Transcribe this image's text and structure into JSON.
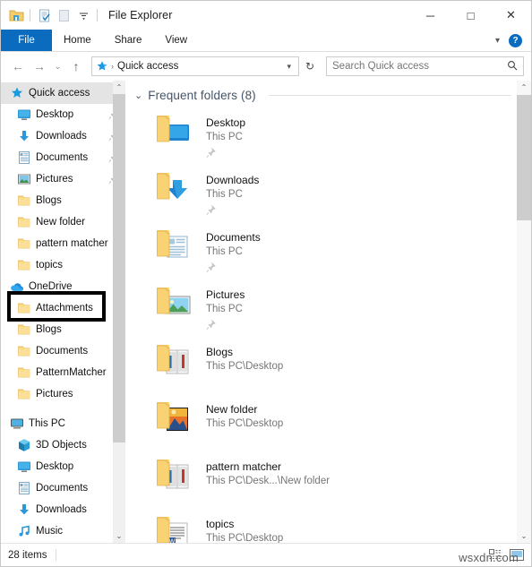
{
  "window": {
    "title": "File Explorer",
    "quick_access_toolbar": [
      {
        "icon": "folder-icon",
        "name": "explorer-icon"
      },
      {
        "icon": "properties-icon",
        "name": "properties-icon"
      },
      {
        "icon": "new-folder-icon",
        "name": "new-folder-icon"
      },
      {
        "icon": "chevron-down-icon",
        "name": "customize-qat-icon"
      }
    ],
    "controls": {
      "minimize": "─",
      "maximize": "□",
      "close": "✕"
    }
  },
  "ribbon": {
    "file_tab": "File",
    "tabs": [
      "Home",
      "Share",
      "View"
    ],
    "minimize_ribbon": "chevron-down-icon",
    "help": "?"
  },
  "addressbar": {
    "back": "←",
    "forward": "→",
    "recent": "⌄",
    "up": "↑",
    "crumb_icon": "quick-access-star-icon",
    "crumb_separator": "›",
    "crumb_label": "Quick access",
    "dropdown": "⌄",
    "refresh": "↻",
    "search_placeholder": "Search Quick access",
    "search_value": "",
    "search_icon": "search-icon"
  },
  "nav_pane": {
    "items": [
      {
        "label": "Quick access",
        "icon": "quick-access-star-icon",
        "level": 0,
        "selected": true,
        "pinned": false
      },
      {
        "label": "Desktop",
        "icon": "desktop-icon",
        "level": 1,
        "selected": false,
        "pinned": true
      },
      {
        "label": "Downloads",
        "icon": "downloads-icon",
        "level": 1,
        "selected": false,
        "pinned": true
      },
      {
        "label": "Documents",
        "icon": "documents-icon",
        "level": 1,
        "selected": false,
        "pinned": true
      },
      {
        "label": "Pictures",
        "icon": "pictures-icon",
        "level": 1,
        "selected": false,
        "pinned": true
      },
      {
        "label": "Blogs",
        "icon": "folder-icon",
        "level": 1,
        "selected": false,
        "pinned": false
      },
      {
        "label": "New folder",
        "icon": "folder-icon",
        "level": 1,
        "selected": false,
        "pinned": false
      },
      {
        "label": "pattern matcher",
        "icon": "folder-icon",
        "level": 1,
        "selected": false,
        "pinned": false
      },
      {
        "label": "topics",
        "icon": "folder-icon",
        "level": 1,
        "selected": false,
        "pinned": false
      },
      {
        "label": "OneDrive",
        "icon": "onedrive-cloud-icon",
        "level": 0,
        "selected": false,
        "pinned": false,
        "highlighted": true
      },
      {
        "label": "Attachments",
        "icon": "folder-icon",
        "level": 1,
        "selected": false,
        "pinned": false
      },
      {
        "label": "Blogs",
        "icon": "folder-icon",
        "level": 1,
        "selected": false,
        "pinned": false
      },
      {
        "label": "Documents",
        "icon": "folder-icon",
        "level": 1,
        "selected": false,
        "pinned": false
      },
      {
        "label": "PatternMatcher",
        "icon": "folder-icon",
        "level": 1,
        "selected": false,
        "pinned": false
      },
      {
        "label": "Pictures",
        "icon": "folder-icon",
        "level": 1,
        "selected": false,
        "pinned": false
      },
      {
        "label": "This PC",
        "icon": "this-pc-icon",
        "level": 0,
        "selected": false,
        "pinned": false,
        "spacer_above": true
      },
      {
        "label": "3D Objects",
        "icon": "3d-objects-icon",
        "level": 1,
        "selected": false,
        "pinned": false
      },
      {
        "label": "Desktop",
        "icon": "desktop-icon",
        "level": 1,
        "selected": false,
        "pinned": false
      },
      {
        "label": "Documents",
        "icon": "documents-icon",
        "level": 1,
        "selected": false,
        "pinned": false
      },
      {
        "label": "Downloads",
        "icon": "downloads-icon",
        "level": 1,
        "selected": false,
        "pinned": false
      },
      {
        "label": "Music",
        "icon": "music-icon",
        "level": 1,
        "selected": false,
        "pinned": false
      }
    ],
    "scrollbar": {
      "up": "⌃",
      "down": "⌄"
    }
  },
  "content": {
    "group_header": "Frequent folders (8)",
    "group_chevron": "⌄",
    "tiles": [
      {
        "name": "Desktop",
        "path": "This PC",
        "icon": "folder-desktop-icon",
        "pinned": true
      },
      {
        "name": "Downloads",
        "path": "This PC",
        "icon": "folder-downloads-icon",
        "pinned": true
      },
      {
        "name": "Documents",
        "path": "This PC",
        "icon": "folder-documents-icon",
        "pinned": true
      },
      {
        "name": "Pictures",
        "path": "This PC",
        "icon": "folder-pictures-icon",
        "pinned": true
      },
      {
        "name": "Blogs",
        "path": "This PC\\Desktop",
        "icon": "folder-books-icon",
        "pinned": false
      },
      {
        "name": "New folder",
        "path": "This PC\\Desktop",
        "icon": "folder-images-icon",
        "pinned": false
      },
      {
        "name": "pattern matcher",
        "path": "This PC\\Desk...\\New folder",
        "icon": "folder-books-icon",
        "pinned": false
      },
      {
        "name": "topics",
        "path": "This PC\\Desktop",
        "icon": "folder-docs-icon",
        "pinned": false
      }
    ],
    "scrollbar": {
      "up": "⌃",
      "down": "⌄"
    }
  },
  "statusbar": {
    "item_count": "28 items",
    "view_buttons": [
      {
        "name": "details-view-button",
        "icon": "details-view-icon"
      },
      {
        "name": "large-icons-view-button",
        "icon": "large-icons-view-icon"
      }
    ]
  },
  "watermark": "wsxdn.com",
  "colors": {
    "accent": "#0b6cbf",
    "group_header": "#44546a",
    "folder": "#fbd478",
    "highlight_box": "#000000",
    "selection": "#e4e4e4"
  }
}
